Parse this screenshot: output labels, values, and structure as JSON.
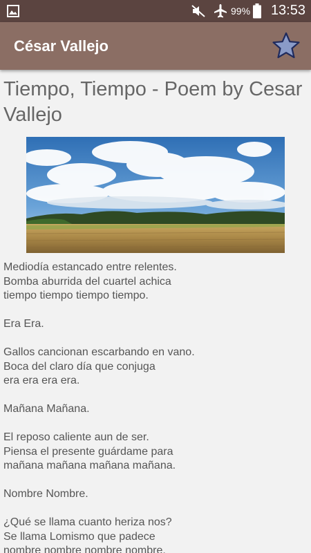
{
  "status_bar": {
    "battery_percent": "99%",
    "time": "13:53",
    "icons": [
      "gallery-icon",
      "mute-icon",
      "airplane-mode-icon",
      "battery-icon"
    ]
  },
  "app_bar": {
    "title": "César Vallejo",
    "favorite_icon": "star-icon"
  },
  "poem": {
    "title": "Tiempo, Tiempo - Poem by Cesar Vallejo",
    "image_description": "landscape-field-clouds",
    "stanzas": [
      [
        "Mediodía estancado entre relentes.",
        "Bomba aburrida del cuartel achica",
        "tiempo tiempo tiempo tiempo."
      ],
      [
        "Era Era."
      ],
      [
        "Gallos cancionan escarbando en vano.",
        "Boca del claro día que conjuga",
        "era era era era."
      ],
      [
        "Mañana Mañana."
      ],
      [
        "El reposo caliente aun de ser.",
        "Piensa el presente guárdame para",
        "mañana mañana mañana mañana."
      ],
      [
        "Nombre Nombre."
      ],
      [
        "¿Qué se llama cuanto heriza nos?",
        "Se llama Lomismo que padece",
        "nombre nombre nombre nombre."
      ]
    ]
  },
  "colors": {
    "status_bar": "#5b4440",
    "app_bar": "#8b6e64",
    "background": "#f2f2f2",
    "star_fill": "#8a9bc8"
  }
}
